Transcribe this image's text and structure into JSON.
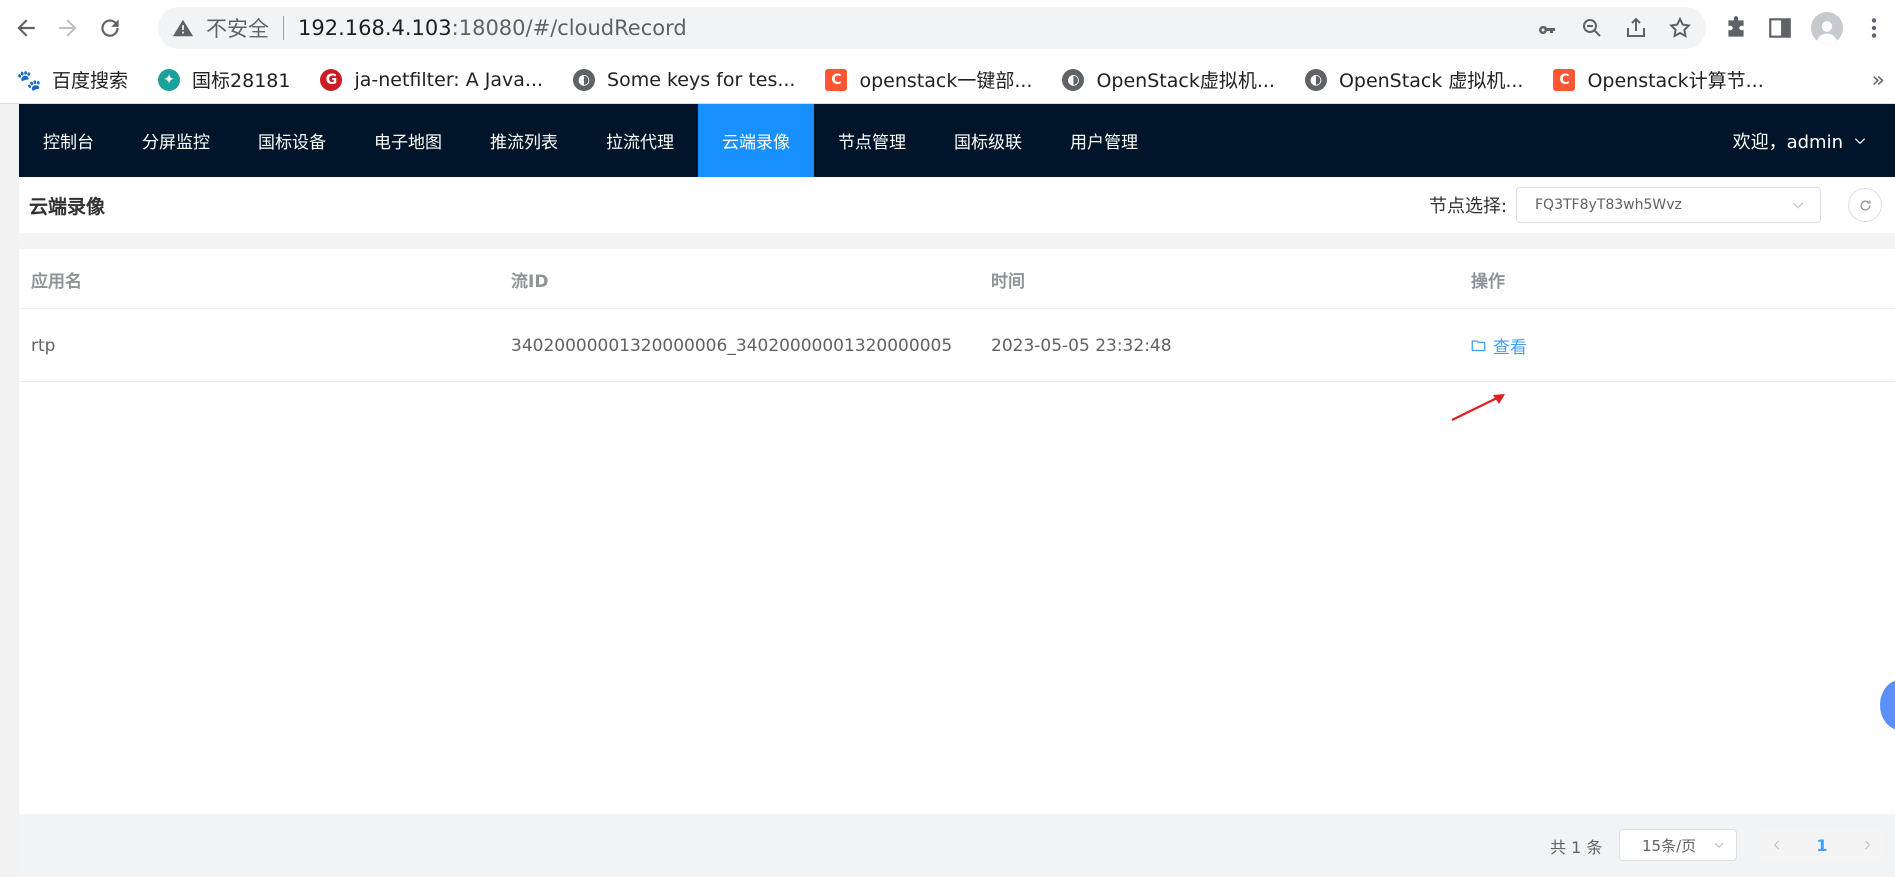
{
  "browser": {
    "insecure_label": "不安全",
    "url_host": "192.168.4.103",
    "url_path": ":18080/#/cloudRecord",
    "bookmarks": [
      {
        "label": "百度搜索",
        "icon": "baidu-icon",
        "color": "#2932e1"
      },
      {
        "label": "国标28181",
        "icon": "bird-icon",
        "color": "#1aa29a"
      },
      {
        "label": "ja-netfilter: A Java...",
        "icon": "gitee-icon",
        "color": "#c71d23"
      },
      {
        "label": "Some keys for tes...",
        "icon": "globe-icon",
        "color": "#5f6368"
      },
      {
        "label": "openstack一键部...",
        "icon": "csdn-icon",
        "color": "#fc5531"
      },
      {
        "label": "OpenStack虚拟机...",
        "icon": "globe-icon",
        "color": "#5f6368"
      },
      {
        "label": "OpenStack 虚拟机...",
        "icon": "globe-icon",
        "color": "#5f6368"
      },
      {
        "label": "Openstack计算节...",
        "icon": "csdn-icon",
        "color": "#fc5531"
      }
    ]
  },
  "nav": {
    "items": [
      {
        "label": "控制台",
        "active": false
      },
      {
        "label": "分屏监控",
        "active": false
      },
      {
        "label": "国标设备",
        "active": false
      },
      {
        "label": "电子地图",
        "active": false
      },
      {
        "label": "推流列表",
        "active": false
      },
      {
        "label": "拉流代理",
        "active": false
      },
      {
        "label": "云端录像",
        "active": true
      },
      {
        "label": "节点管理",
        "active": false
      },
      {
        "label": "国标级联",
        "active": false
      },
      {
        "label": "用户管理",
        "active": false
      }
    ],
    "user_label": "欢迎，admin"
  },
  "page": {
    "title": "云端录像",
    "node_label": "节点选择:",
    "node_value": "FQ3TF8yT83wh5Wvz"
  },
  "table": {
    "headers": {
      "app": "应用名",
      "stream": "流ID",
      "time": "时间",
      "action": "操作"
    },
    "rows": [
      {
        "app": "rtp",
        "stream": "34020000001320000006_34020000001320000005",
        "time": "2023-05-05 23:32:48",
        "action": "查看"
      }
    ]
  },
  "pager": {
    "total": "共 1 条",
    "page_size": "15条/页",
    "current": "1"
  },
  "colors": {
    "accent": "#1890ff",
    "nav_bg": "#001529",
    "link": "#409eff"
  }
}
